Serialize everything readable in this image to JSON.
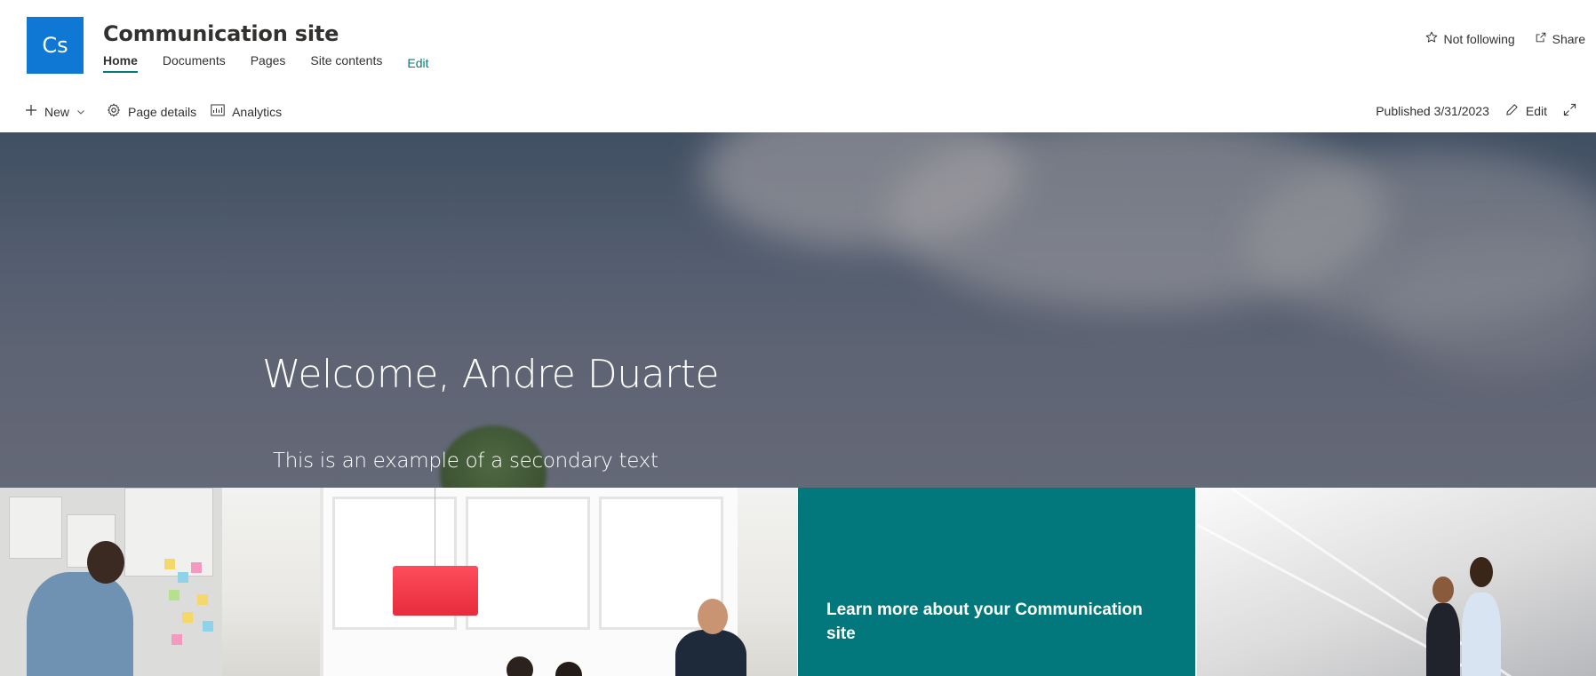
{
  "site": {
    "logo_text": "Cs",
    "title": "Communication site",
    "brand_color": "#0f78d4",
    "theme_color": "#03787c"
  },
  "nav": {
    "items": [
      {
        "label": "Home",
        "active": true
      },
      {
        "label": "Documents",
        "active": false
      },
      {
        "label": "Pages",
        "active": false
      },
      {
        "label": "Site contents",
        "active": false
      }
    ],
    "edit_label": "Edit"
  },
  "header_actions": {
    "follow_label": "Not following",
    "follow_icon": "star-outline-icon",
    "share_label": "Share",
    "share_icon": "share-icon"
  },
  "command_bar": {
    "new_label": "New",
    "page_details_label": "Page details",
    "analytics_label": "Analytics",
    "published_text": "Published 3/31/2023",
    "edit_label": "Edit"
  },
  "hero": {
    "title": "Welcome, Andre Duarte",
    "subtitle": "This is an example of a secondary text"
  },
  "tiles": [
    {
      "name": "office-meeting-photo",
      "caption": ""
    },
    {
      "name": "learn-more-tile",
      "caption": "Learn more about your Communication site"
    },
    {
      "name": "business-people-photo",
      "caption": ""
    }
  ]
}
